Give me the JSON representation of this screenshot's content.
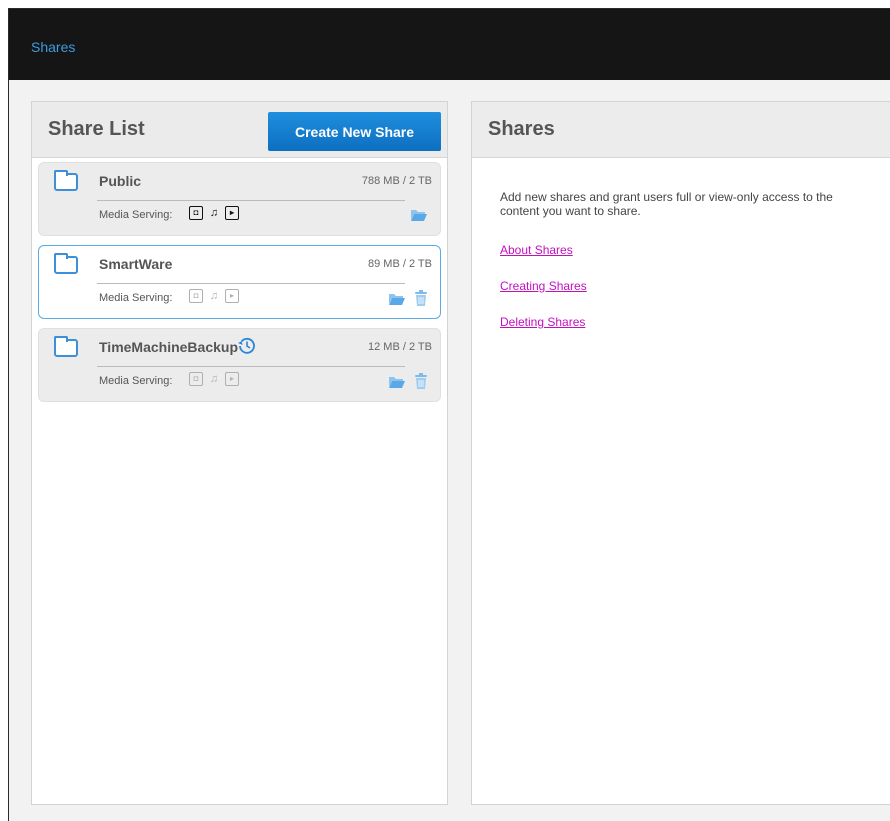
{
  "header": {
    "title": "Shares"
  },
  "share_list_panel": {
    "title": "Share List",
    "create_button_label": "Create New Share",
    "items": [
      {
        "name": "Public",
        "size": "788 MB / 2 TB",
        "media_label": "Media Serving:",
        "media_enabled": true,
        "selected": false,
        "deletable": false,
        "time_machine": false
      },
      {
        "name": "SmartWare",
        "size": "89 MB / 2 TB",
        "media_label": "Media Serving:",
        "media_enabled": false,
        "selected": true,
        "deletable": true,
        "time_machine": false
      },
      {
        "name": "TimeMachineBackup",
        "size": "12 MB / 2 TB",
        "media_label": "Media Serving:",
        "media_enabled": false,
        "selected": false,
        "deletable": true,
        "time_machine": true
      }
    ]
  },
  "info_panel": {
    "title": "Shares",
    "description": "Add new shares and grant users full or view-only access to the content you want to share.",
    "links": [
      "About Shares",
      "Creating Shares",
      "Deleting Shares"
    ]
  },
  "colors": {
    "topbar_bg": "#151515",
    "title_link": "#3d9be0",
    "accent_blue": "#0d6fc0",
    "icon_blue": "#3d8fd8",
    "help_link": "#c40fbf"
  },
  "icons": [
    "folder-icon",
    "photo-icon",
    "music-icon",
    "video-icon",
    "open-folder-icon",
    "trash-icon",
    "time-machine-icon"
  ]
}
